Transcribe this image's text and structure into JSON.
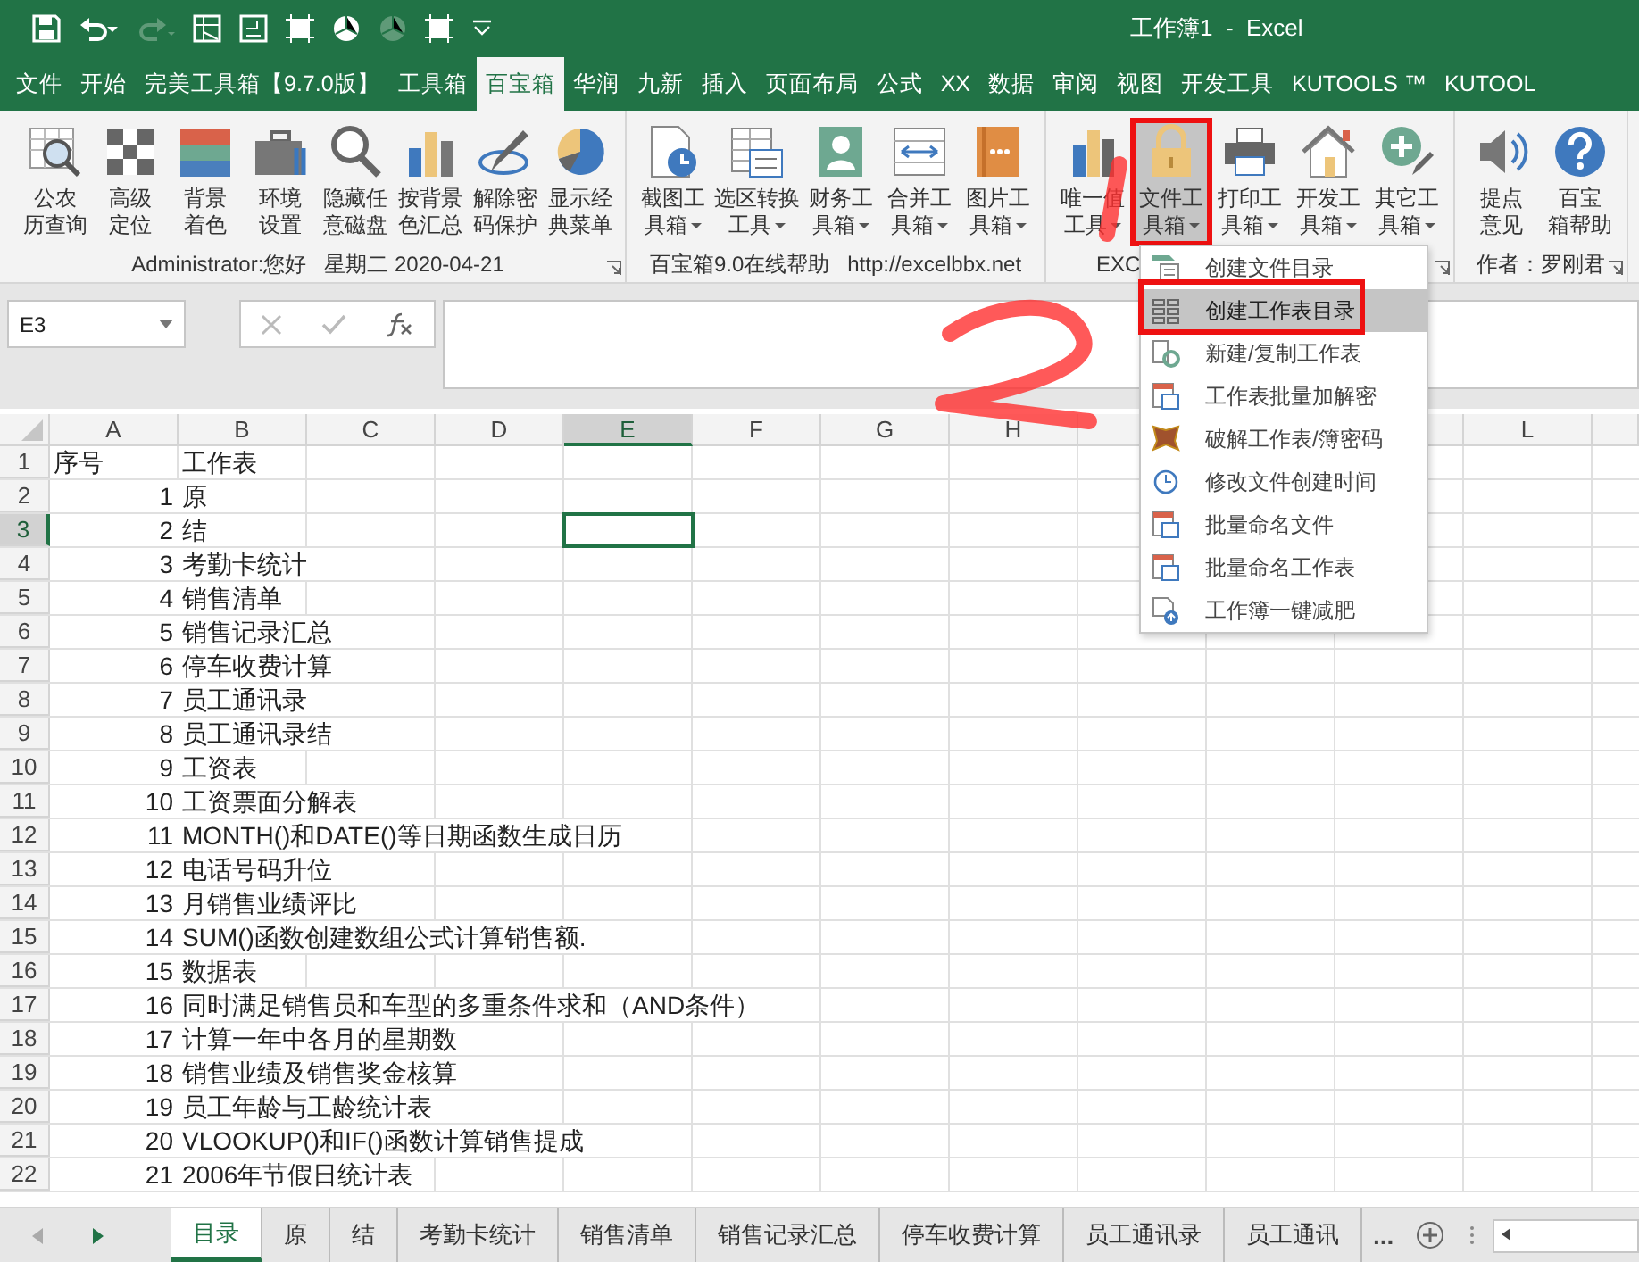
{
  "title_bar": {
    "title": "工作簿1  -  Excel"
  },
  "ribbon_tabs": [
    {
      "label": "文件",
      "selected": false
    },
    {
      "label": "开始",
      "selected": false
    },
    {
      "label": "完美工具箱【9.7.0版】",
      "selected": false
    },
    {
      "label": "工具箱",
      "selected": false
    },
    {
      "label": "百宝箱",
      "selected": true
    },
    {
      "label": "华润",
      "selected": false
    },
    {
      "label": "九新",
      "selected": false
    },
    {
      "label": "插入",
      "selected": false
    },
    {
      "label": "页面布局",
      "selected": false
    },
    {
      "label": "公式",
      "selected": false
    },
    {
      "label": "XX",
      "selected": false
    },
    {
      "label": "数据",
      "selected": false
    },
    {
      "label": "审阅",
      "selected": false
    },
    {
      "label": "视图",
      "selected": false
    },
    {
      "label": "开发工具",
      "selected": false
    },
    {
      "label": "KUTOOLS ™",
      "selected": false
    },
    {
      "label": "KUTOOL",
      "selected": false
    }
  ],
  "ribbon_groups": [
    {
      "label": "Administrator:您好   星期二 2020-04-21",
      "launcher": true,
      "buttons": [
        {
          "lines": [
            "公农",
            "历查询"
          ],
          "dropdown": false,
          "pressed": false
        },
        {
          "lines": [
            "高级",
            "定位"
          ],
          "dropdown": false,
          "pressed": false
        },
        {
          "lines": [
            "背景",
            "着色"
          ],
          "dropdown": false,
          "pressed": false
        },
        {
          "lines": [
            "环境",
            "设置"
          ],
          "dropdown": false,
          "pressed": false
        },
        {
          "lines": [
            "隐藏任",
            "意磁盘"
          ],
          "dropdown": false,
          "pressed": false
        },
        {
          "lines": [
            "按背景",
            "色汇总"
          ],
          "dropdown": false,
          "pressed": false
        },
        {
          "lines": [
            "解除密",
            "码保护"
          ],
          "dropdown": false,
          "pressed": false
        },
        {
          "lines": [
            "显示经",
            "典菜单"
          ],
          "dropdown": false,
          "pressed": false
        }
      ]
    },
    {
      "label": "百宝箱9.0在线帮助   http://excelbbx.net",
      "buttons": [
        {
          "lines": [
            "截图工",
            "具箱"
          ],
          "dropdown": true,
          "pressed": false
        },
        {
          "lines": [
            "选区转换",
            "工具"
          ],
          "dropdown": true,
          "pressed": false
        },
        {
          "lines": [
            "财务工",
            "具箱"
          ],
          "dropdown": true,
          "pressed": false
        },
        {
          "lines": [
            "合并工",
            "具箱"
          ],
          "dropdown": true,
          "pressed": false
        },
        {
          "lines": [
            "图片工",
            "具箱"
          ],
          "dropdown": true,
          "pressed": false
        }
      ]
    },
    {
      "label": "EXC",
      "launcher": true,
      "buttons": [
        {
          "lines": [
            "唯一值",
            "工具"
          ],
          "dropdown": true,
          "pressed": false
        },
        {
          "lines": [
            "文件工",
            "具箱"
          ],
          "dropdown": true,
          "pressed": true
        },
        {
          "lines": [
            "打印工",
            "具箱"
          ],
          "dropdown": true,
          "pressed": false
        },
        {
          "lines": [
            "开发工",
            "具箱"
          ],
          "dropdown": true,
          "pressed": false
        },
        {
          "lines": [
            "其它工",
            "具箱"
          ],
          "dropdown": true,
          "pressed": false
        }
      ]
    },
    {
      "label": "作者：罗刚君",
      "launcher": true,
      "buttons": [
        {
          "lines": [
            "提点",
            "意见"
          ],
          "dropdown": false,
          "pressed": false
        },
        {
          "lines": [
            "百宝",
            "箱帮助"
          ],
          "dropdown": false,
          "pressed": false
        }
      ]
    }
  ],
  "formula_bar": {
    "name_box": "E3"
  },
  "columns": [
    {
      "label": "A",
      "selected": false
    },
    {
      "label": "B",
      "selected": false
    },
    {
      "label": "C",
      "selected": false
    },
    {
      "label": "D",
      "selected": false
    },
    {
      "label": "E",
      "selected": true
    },
    {
      "label": "F",
      "selected": false
    },
    {
      "label": "G",
      "selected": false
    },
    {
      "label": "H",
      "selected": false
    },
    {
      "selected": false
    },
    {},
    {
      "selected": false
    },
    {
      "label": "L",
      "selected": false
    },
    {
      "selected": false
    }
  ],
  "rows": [
    {
      "header": "1",
      "selected": false,
      "kind": "heading",
      "a": "序号",
      "b": "工作表"
    },
    {
      "header": "2",
      "selected": false,
      "kind": "data",
      "a": "1",
      "b": "原"
    },
    {
      "header": "3",
      "selected": true,
      "kind": "data",
      "a": "2",
      "b": "结"
    },
    {
      "header": "4",
      "selected": false,
      "kind": "data",
      "a": "3",
      "b": "考勤卡统计"
    },
    {
      "header": "5",
      "selected": false,
      "kind": "data",
      "a": "4",
      "b": "销售清单"
    },
    {
      "header": "6",
      "selected": false,
      "kind": "data",
      "a": "5",
      "b": "销售记录汇总"
    },
    {
      "header": "7",
      "selected": false,
      "kind": "data",
      "a": "6",
      "b": "停车收费计算"
    },
    {
      "header": "8",
      "selected": false,
      "kind": "data",
      "a": "7",
      "b": "员工通讯录"
    },
    {
      "header": "9",
      "selected": false,
      "kind": "data",
      "a": "8",
      "b": "员工通讯录结"
    },
    {
      "header": "10",
      "selected": false,
      "kind": "data",
      "a": "9",
      "b": "工资表"
    },
    {
      "header": "11",
      "selected": false,
      "kind": "data",
      "a": "10",
      "b": "工资票面分解表"
    },
    {
      "header": "12",
      "selected": false,
      "kind": "data",
      "a": "11",
      "b": "MONTH()和DATE()等日期函数生成日历"
    },
    {
      "header": "13",
      "selected": false,
      "kind": "data",
      "a": "12",
      "b": "电话号码升位"
    },
    {
      "header": "14",
      "selected": false,
      "kind": "data",
      "a": "13",
      "b": "月销售业绩评比"
    },
    {
      "header": "15",
      "selected": false,
      "kind": "data",
      "a": "14",
      "b": "SUM()函数创建数组公式计算销售额."
    },
    {
      "header": "16",
      "selected": false,
      "kind": "data",
      "a": "15",
      "b": "数据表"
    },
    {
      "header": "17",
      "selected": false,
      "kind": "data",
      "a": "16",
      "b": "同时满足销售员和车型的多重条件求和（AND条件）"
    },
    {
      "header": "18",
      "selected": false,
      "kind": "data",
      "a": "17",
      "b": "计算一年中各月的星期数"
    },
    {
      "header": "19",
      "selected": false,
      "kind": "data",
      "a": "18",
      "b": "销售业绩及销售奖金核算"
    },
    {
      "header": "20",
      "selected": false,
      "kind": "data",
      "a": "19",
      "b": "员工年龄与工龄统计表"
    },
    {
      "header": "21",
      "selected": false,
      "kind": "data",
      "a": "20",
      "b": "VLOOKUP()和IF()函数计算销售提成"
    },
    {
      "header": "22",
      "selected": false,
      "kind": "data",
      "a": "21",
      "b": "2006年节假日统计表"
    }
  ],
  "dropdown_menu": [
    {
      "label": "创建文件目录",
      "selected": false
    },
    {
      "label": "创建工作表目录",
      "selected": true
    },
    {
      "label": "新建/复制工作表",
      "selected": false
    },
    {
      "label": "工作表批量加解密",
      "selected": false
    },
    {
      "label": "破解工作表/簿密码",
      "selected": false
    },
    {
      "label": "修改文件创建时间",
      "selected": false
    },
    {
      "label": "批量命名文件",
      "selected": false
    },
    {
      "label": "批量命名工作表",
      "selected": false
    },
    {
      "label": "工作簿一键减肥",
      "selected": false
    }
  ],
  "sheet_tabs": [
    {
      "label": "目录",
      "selected": true
    },
    {
      "label": "原",
      "selected": false
    },
    {
      "label": "结",
      "selected": false
    },
    {
      "label": "考勤卡统计",
      "selected": false
    },
    {
      "label": "销售清单",
      "selected": false
    },
    {
      "label": "销售记录汇总",
      "selected": false
    },
    {
      "label": "停车收费计算",
      "selected": false
    },
    {
      "label": "员工通讯录",
      "selected": false
    },
    {
      "label": "员工通讯",
      "selected": false
    }
  ],
  "more_sheets": "..."
}
